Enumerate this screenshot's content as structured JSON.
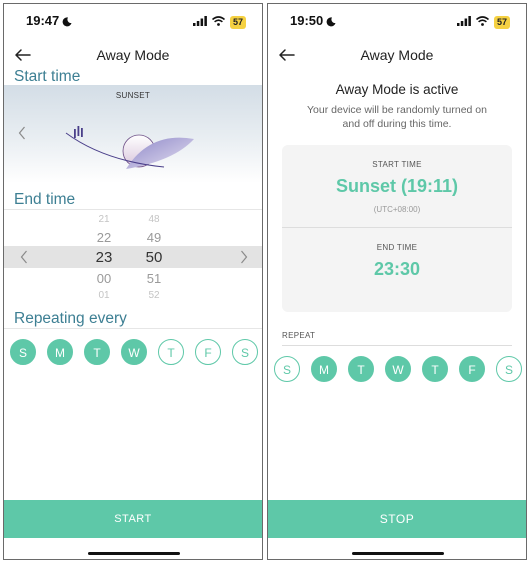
{
  "left": {
    "status": {
      "time": "19:47",
      "battery": "57"
    },
    "title": "Away Mode",
    "start_time_label": "Start time",
    "sunset_label": "SUNSET",
    "end_time_label": "End time",
    "picker": {
      "hours": [
        "21",
        "22",
        "23",
        "00",
        "01"
      ],
      "minutes": [
        "48",
        "49",
        "50",
        "51",
        "52"
      ]
    },
    "repeat_label": "Repeating every",
    "days": [
      {
        "label": "S",
        "on": true
      },
      {
        "label": "M",
        "on": true
      },
      {
        "label": "T",
        "on": true
      },
      {
        "label": "W",
        "on": true
      },
      {
        "label": "T",
        "on": false
      },
      {
        "label": "F",
        "on": false
      },
      {
        "label": "S",
        "on": false
      }
    ],
    "button": "START"
  },
  "right": {
    "status": {
      "time": "19:50",
      "battery": "57"
    },
    "title": "Away Mode",
    "active_title": "Away Mode is active",
    "active_desc": "Your device will be randomly turned on and off during this time.",
    "start_label": "START TIME",
    "start_value": "Sunset (19:11)",
    "start_tz": "(UTC+08:00)",
    "end_label": "END TIME",
    "end_value": "23:30",
    "repeat_label": "REPEAT",
    "days": [
      {
        "label": "S",
        "on": false
      },
      {
        "label": "M",
        "on": true
      },
      {
        "label": "T",
        "on": true
      },
      {
        "label": "W",
        "on": true
      },
      {
        "label": "T",
        "on": true
      },
      {
        "label": "F",
        "on": true
      },
      {
        "label": "S",
        "on": false
      }
    ],
    "button": "STOP"
  },
  "colors": {
    "accent": "#5ec8a8",
    "section_title": "#3d7f93",
    "battery": "#f5d142"
  }
}
